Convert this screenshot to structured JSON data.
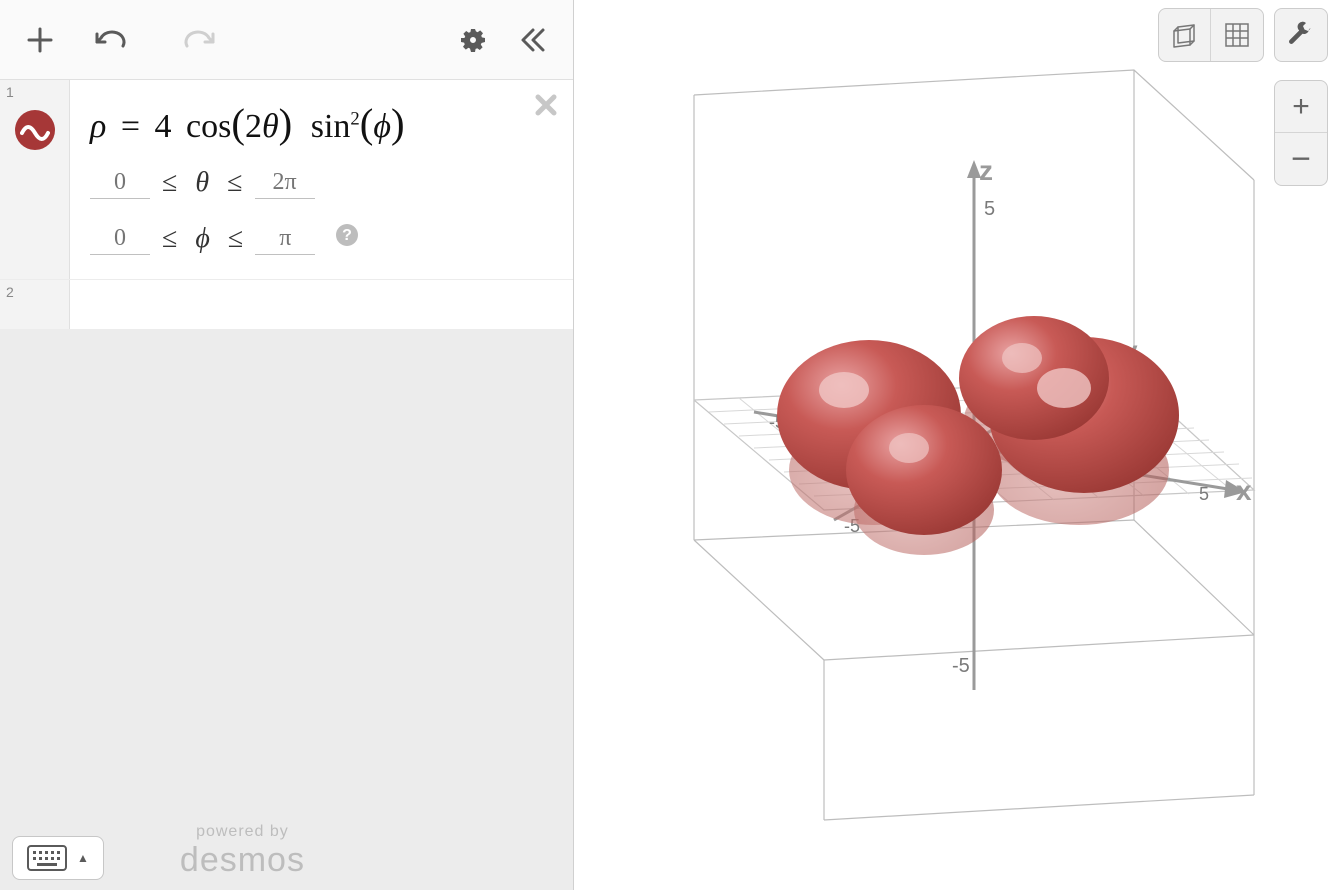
{
  "toolbar": {
    "add_icon": "plus",
    "undo_icon": "undo",
    "redo_icon": "redo",
    "settings_icon": "gear",
    "collapse_icon": "chevron-left-double"
  },
  "expressions": [
    {
      "index": "1",
      "kind": "surface",
      "color": "#a63737",
      "formula_display": "ρ = 4 cos(2θ) sin²(ϕ)",
      "formula": {
        "lhs": "ρ",
        "rhs_parts": [
          "4",
          "cos(2θ)",
          "sin",
          "2",
          "(ϕ)"
        ]
      },
      "bounds": [
        {
          "var": "θ",
          "min_placeholder": "0",
          "max_placeholder": "2π",
          "min": "",
          "max": ""
        },
        {
          "var": "ϕ",
          "min_placeholder": "0",
          "max_placeholder": "π",
          "min": "",
          "max": "",
          "help": true
        }
      ]
    },
    {
      "index": "2",
      "kind": "empty"
    }
  ],
  "footer": {
    "keyboard_icon": "keyboard",
    "keyboard_caret": "▲",
    "powered_label": "powered by",
    "brand": "desmos"
  },
  "graph3d": {
    "axes": {
      "x": "x",
      "y": "y",
      "z": "z"
    },
    "ticks": {
      "x": [
        -5,
        5
      ],
      "y": [
        -5,
        5
      ],
      "z": [
        -5,
        5
      ]
    },
    "tick_labels": [
      "-5",
      "5",
      "-5",
      "-5",
      "5"
    ],
    "surface_color": "#bf4a4a",
    "surface_equation": "ρ = 4 cos(2θ) sin²(ϕ)",
    "lobes": 4
  },
  "right_controls": {
    "cube_icon": "cube-wireframe",
    "grid_icon": "grid",
    "wrench_icon": "wrench",
    "zoom_in": "+",
    "zoom_out": "−"
  }
}
